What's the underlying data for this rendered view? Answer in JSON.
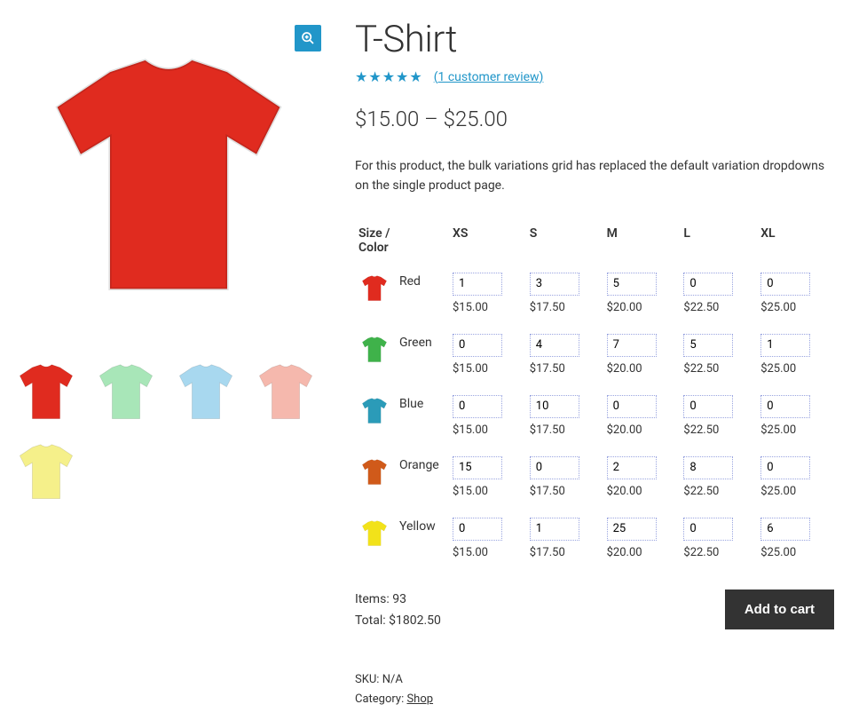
{
  "product": {
    "title": "T-Shirt",
    "rating_stars": "★★★★★",
    "review_link": "(1 customer review)",
    "price_range": "$15.00 – $25.00",
    "description": "For this product, the bulk variations grid has replaced the default variation dropdowns on the single product page.",
    "sku_label": "SKU:",
    "sku_value": "N/A",
    "category_label": "Category:",
    "category_value": "Shop"
  },
  "grid": {
    "corner_label": "Size / Color",
    "sizes": [
      "XS",
      "S",
      "M",
      "L",
      "XL"
    ],
    "colors": [
      {
        "name": "Red",
        "hex": "#e02b1f"
      },
      {
        "name": "Green",
        "hex": "#3fb24a"
      },
      {
        "name": "Blue",
        "hex": "#2b9bb8"
      },
      {
        "name": "Orange",
        "hex": "#d05a1a"
      },
      {
        "name": "Yellow",
        "hex": "#f2e21a"
      }
    ],
    "prices": [
      "$15.00",
      "$17.50",
      "$20.00",
      "$22.50",
      "$25.00"
    ],
    "qty": [
      [
        1,
        3,
        5,
        0,
        0
      ],
      [
        0,
        4,
        7,
        5,
        1
      ],
      [
        0,
        10,
        0,
        0,
        0
      ],
      [
        15,
        0,
        2,
        8,
        0
      ],
      [
        0,
        1,
        25,
        0,
        6
      ]
    ]
  },
  "totals": {
    "items_label": "Items:",
    "items_value": "93",
    "total_label": "Total:",
    "total_value": "$1802.50"
  },
  "buttons": {
    "add_to_cart": "Add to cart"
  },
  "gallery": {
    "main_color": "#e02b1f",
    "thumbs": [
      "#e02b1f",
      "#a8e6b8",
      "#a8d8ef",
      "#f5b8ad",
      "#f5f08a"
    ]
  }
}
